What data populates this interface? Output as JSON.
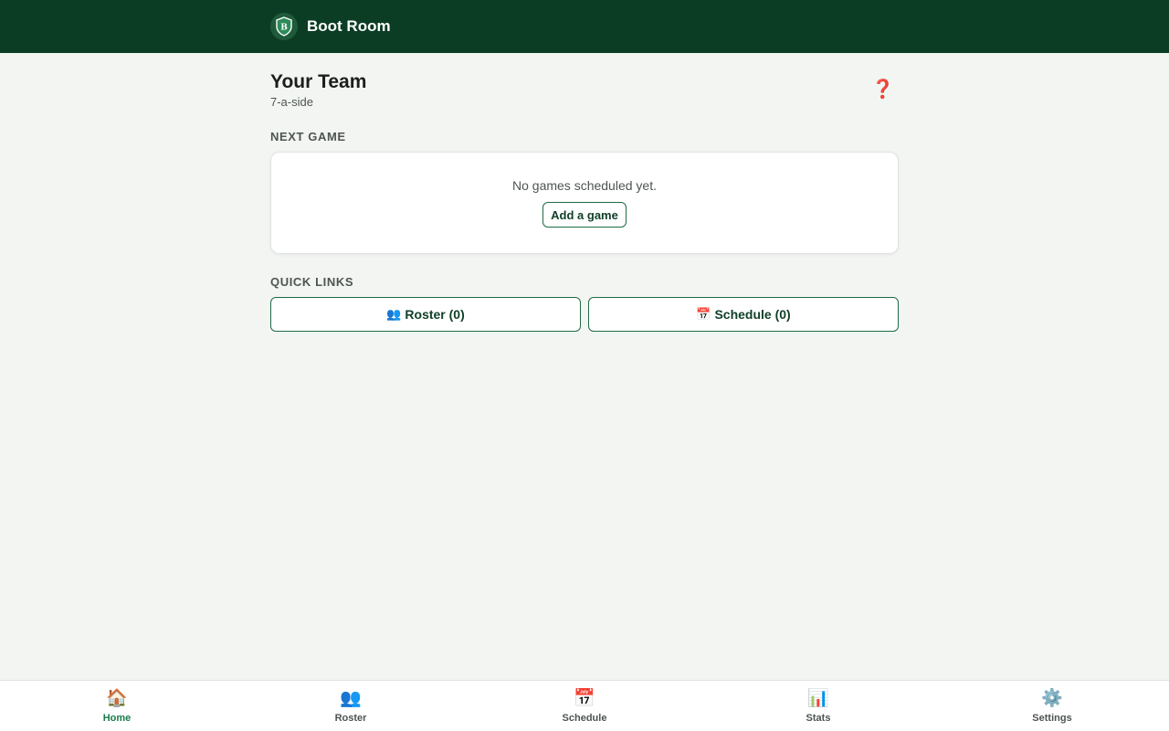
{
  "app": {
    "title": "Boot Room",
    "logo_letter": "B",
    "brand_color": "#0b3d24",
    "accent_color": "#1b7a4b"
  },
  "team": {
    "name": "Your Team",
    "format": "7-a-side",
    "help_icon": "❓"
  },
  "next_game": {
    "section_label": "NEXT GAME",
    "empty_text": "No games scheduled yet.",
    "add_label": "Add a game"
  },
  "quick_links": {
    "section_label": "QUICK LINKS",
    "roster": {
      "icon": "👥",
      "label": "Roster (0)"
    },
    "schedule": {
      "icon": "📅",
      "label": "Schedule (0)"
    }
  },
  "bottom_nav": {
    "active": "Home",
    "items": [
      {
        "icon": "🏠",
        "label": "Home"
      },
      {
        "icon": "👥",
        "label": "Roster"
      },
      {
        "icon": "📅",
        "label": "Schedule"
      },
      {
        "icon": "📊",
        "label": "Stats"
      },
      {
        "icon": "⚙️",
        "label": "Settings"
      }
    ]
  }
}
